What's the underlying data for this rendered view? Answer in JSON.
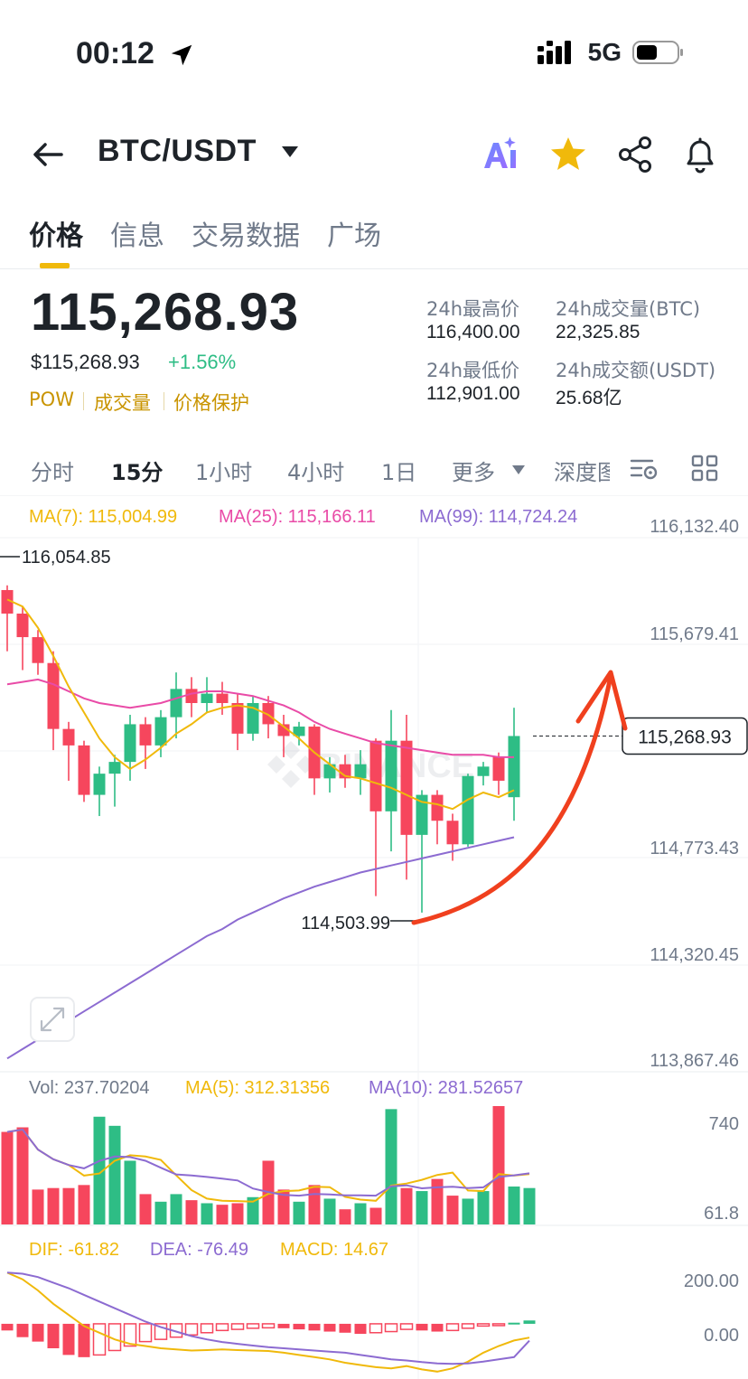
{
  "status_bar": {
    "time": "00:12",
    "network": "5G"
  },
  "header": {
    "pair": "BTC/USDT",
    "icons": [
      "back-arrow-icon",
      "ai-icon",
      "star-icon",
      "share-icon",
      "bell-icon"
    ]
  },
  "tabs": [
    "价格",
    "信息",
    "交易数据",
    "广场"
  ],
  "price": {
    "last": "115,268.93",
    "usd": "$115,268.93",
    "change": "+1.56%",
    "tags": [
      "POW",
      "成交量",
      "价格保护"
    ]
  },
  "stats": {
    "high_label": "24h最高价",
    "high_value": "116,400.00",
    "low_label": "24h最低价",
    "low_value": "112,901.00",
    "vol_btc_label": "24h成交量(BTC)",
    "vol_btc_value": "22,325.85",
    "vol_usdt_label": "24h成交额(USDT)",
    "vol_usdt_value": "25.68亿"
  },
  "intervals": [
    "分时",
    "15分",
    "1小时",
    "4小时",
    "1日",
    "更多",
    "深度图"
  ],
  "colors": {
    "up": "#2ebd85",
    "down": "#f6465d",
    "ma7": "#f0b90b",
    "ma25": "#e94ba7",
    "ma99": "#8c6bd1",
    "accent": "#f0b90b",
    "annotation": "#f0401e"
  },
  "chart_data": {
    "type": "candlestick",
    "price_axis": {
      "labels": [
        "116,132.40",
        "115,679.41",
        "115,268.93",
        "114,773.43",
        "114,320.45",
        "113,867.46"
      ]
    },
    "price_range": [
      113867.46,
      116132.4
    ],
    "legend": {
      "ma7": "MA(7): 115,004.99",
      "ma25": "MA(25): 115,166.11",
      "ma99": "MA(99): 114,724.24"
    },
    "annotations": {
      "high": "116,054.85",
      "low": "114,503.99",
      "last": "115,268.93"
    },
    "candles": [
      [
        115860,
        115760,
        115880,
        115600
      ],
      [
        115760,
        115660,
        115790,
        115520
      ],
      [
        115660,
        115550,
        115690,
        115500
      ],
      [
        115550,
        115270,
        115600,
        115180
      ],
      [
        115270,
        115200,
        115300,
        115050
      ],
      [
        115200,
        114990,
        115220,
        114960
      ],
      [
        114990,
        115080,
        115110,
        114900
      ],
      [
        115080,
        115130,
        115160,
        114940
      ],
      [
        115130,
        115290,
        115330,
        115050
      ],
      [
        115290,
        115200,
        115320,
        115100
      ],
      [
        115200,
        115320,
        115350,
        115150
      ],
      [
        115320,
        115440,
        115510,
        115230
      ],
      [
        115440,
        115380,
        115490,
        115320
      ],
      [
        115380,
        115420,
        115490,
        115340
      ],
      [
        115420,
        115380,
        115470,
        115330
      ],
      [
        115380,
        115250,
        115420,
        115180
      ],
      [
        115250,
        115380,
        115410,
        115220
      ],
      [
        115380,
        115290,
        115410,
        115230
      ],
      [
        115290,
        115240,
        115330,
        115150
      ],
      [
        115240,
        115280,
        115300,
        115200
      ],
      [
        115280,
        115060,
        115290,
        114990
      ],
      [
        115060,
        115120,
        115150,
        115000
      ],
      [
        115120,
        115060,
        115160,
        115020
      ],
      [
        115060,
        115120,
        115180,
        114990
      ],
      [
        115220,
        114920,
        115230,
        114560
      ],
      [
        114920,
        115220,
        115350,
        114750
      ],
      [
        115220,
        114820,
        115330,
        114630
      ],
      [
        114820,
        114990,
        115010,
        114490
      ],
      [
        114990,
        114880,
        115010,
        114780
      ],
      [
        114880,
        114780,
        114910,
        114710
      ],
      [
        114780,
        115070,
        115080,
        114770
      ],
      [
        115070,
        115110,
        115130,
        115030
      ],
      [
        115150,
        115050,
        115170,
        114990
      ],
      [
        114980,
        115240,
        115360,
        114880
      ]
    ],
    "ma7": [
      115820,
      115790,
      115700,
      115580,
      115450,
      115340,
      115230,
      115150,
      115100,
      115140,
      115190,
      115250,
      115290,
      115340,
      115360,
      115370,
      115360,
      115330,
      115280,
      115230,
      115170,
      115120,
      115070,
      115060,
      115040,
      115020,
      114990,
      114960,
      114950,
      114930,
      114970,
      115000,
      114980,
      115010
    ],
    "ma25": [
      115460,
      115470,
      115480,
      115460,
      115430,
      115400,
      115380,
      115370,
      115360,
      115370,
      115380,
      115400,
      115420,
      115430,
      115430,
      115420,
      115410,
      115390,
      115370,
      115340,
      115300,
      115270,
      115250,
      115230,
      115210,
      115200,
      115190,
      115180,
      115170,
      115160,
      115160,
      115160,
      115150,
      115150
    ],
    "ma99": [
      113870,
      113910,
      113950,
      113990,
      114030,
      114070,
      114110,
      114150,
      114190,
      114230,
      114270,
      114310,
      114350,
      114390,
      114420,
      114460,
      114490,
      114520,
      114550,
      114575,
      114600,
      114620,
      114640,
      114660,
      114675,
      114690,
      114705,
      114720,
      114735,
      114750,
      114765,
      114780,
      114795,
      114810
    ],
    "volume": {
      "legend": {
        "vol": "Vol: 237.70204",
        "ma5": "MA(5): 312.31356",
        "ma10": "MA(10): 281.52657"
      },
      "axis": [
        "740",
        "61.8"
      ],
      "range": [
        0,
        780
      ],
      "values": [
        610,
        640,
        230,
        240,
        240,
        260,
        710,
        650,
        420,
        200,
        150,
        200,
        160,
        140,
        130,
        140,
        180,
        420,
        230,
        150,
        260,
        170,
        100,
        140,
        110,
        760,
        240,
        220,
        300,
        190,
        170,
        220,
        780,
        250,
        240
      ]
    },
    "macd": {
      "legend": {
        "dif": "DIF: -61.82",
        "dea": "DEA: -76.49",
        "macd": "MACD: 14.67"
      },
      "axis": [
        "200.00",
        "0.00"
      ],
      "range": [
        -240,
        280
      ],
      "dif": [
        230,
        200,
        150,
        90,
        40,
        -10,
        -40,
        -70,
        -90,
        -100,
        -110,
        -115,
        -120,
        -118,
        -115,
        -118,
        -120,
        -122,
        -130,
        -140,
        -150,
        -160,
        -175,
        -185,
        -195,
        -200,
        -190,
        -205,
        -215,
        -200,
        -170,
        -130,
        -100,
        -75,
        -62
      ],
      "dea": [
        230,
        225,
        210,
        185,
        160,
        130,
        100,
        70,
        40,
        10,
        -15,
        -35,
        -55,
        -70,
        -82,
        -90,
        -98,
        -105,
        -110,
        -115,
        -120,
        -125,
        -130,
        -140,
        -150,
        -160,
        -165,
        -172,
        -178,
        -180,
        -178,
        -170,
        -160,
        -150,
        -76
      ],
      "hist": [
        -30,
        -60,
        -80,
        -110,
        -140,
        -150,
        -140,
        -120,
        -100,
        -80,
        -70,
        -60,
        -50,
        -40,
        -30,
        -25,
        -20,
        -18,
        -20,
        -25,
        -30,
        -35,
        -40,
        -45,
        -40,
        -35,
        -25,
        -30,
        -35,
        -30,
        -20,
        -10,
        -5,
        5,
        15
      ]
    }
  }
}
